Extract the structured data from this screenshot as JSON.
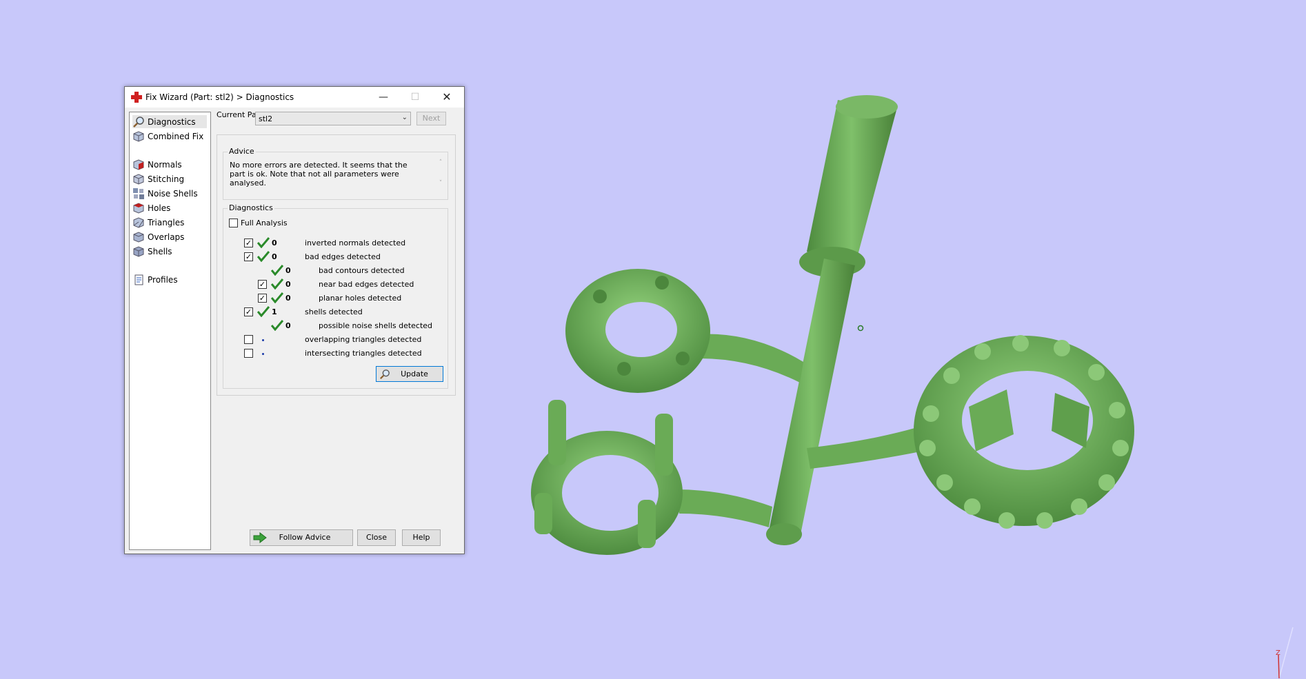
{
  "window": {
    "title": "Fix Wizard (Part: stl2) > Diagnostics",
    "minimize": "—",
    "maximize": "☐",
    "close": "✕"
  },
  "sidebar": {
    "items": [
      {
        "label": "Diagnostics",
        "icon": "magnifier-icon"
      },
      {
        "label": "Combined Fix",
        "icon": "cube-icon"
      },
      {
        "label": "Normals",
        "icon": "normals-cube-icon"
      },
      {
        "label": "Stitching",
        "icon": "stitching-cube-icon"
      },
      {
        "label": "Noise Shells",
        "icon": "noise-shells-icon"
      },
      {
        "label": "Holes",
        "icon": "holes-cube-icon"
      },
      {
        "label": "Triangles",
        "icon": "triangles-cube-icon"
      },
      {
        "label": "Overlaps",
        "icon": "overlaps-cube-icon"
      },
      {
        "label": "Shells",
        "icon": "shells-cube-icon"
      },
      {
        "label": "Profiles",
        "icon": "profile-document-icon"
      }
    ]
  },
  "current_part": {
    "label": "Current Part:",
    "value": "stl2",
    "next": "Next"
  },
  "advice": {
    "legend": "Advice",
    "text": "No more errors are detected. It seems that the part is ok. Note that not all parameters were analysed."
  },
  "diagnostics": {
    "legend": "Diagnostics",
    "full_analysis": "Full Analysis",
    "rows": [
      {
        "count": "0",
        "label": "inverted normals detected"
      },
      {
        "count": "0",
        "label": "bad edges detected"
      },
      {
        "count": "0",
        "label": "bad contours detected"
      },
      {
        "count": "0",
        "label": "near bad edges detected"
      },
      {
        "count": "0",
        "label": "planar holes detected"
      },
      {
        "count": "1",
        "label": "shells detected"
      },
      {
        "count": "0",
        "label": "possible noise shells detected"
      },
      {
        "count": "",
        "label": "overlapping triangles detected"
      },
      {
        "count": "",
        "label": "intersecting triangles detected"
      }
    ],
    "update": "Update"
  },
  "footer": {
    "follow_advice": "Follow Advice",
    "close": "Close",
    "help": "Help"
  },
  "axis": {
    "z": "Z"
  },
  "colors": {
    "background": "#c8c8fa",
    "model": "#6fae5a",
    "check": "#2a8a2a"
  }
}
